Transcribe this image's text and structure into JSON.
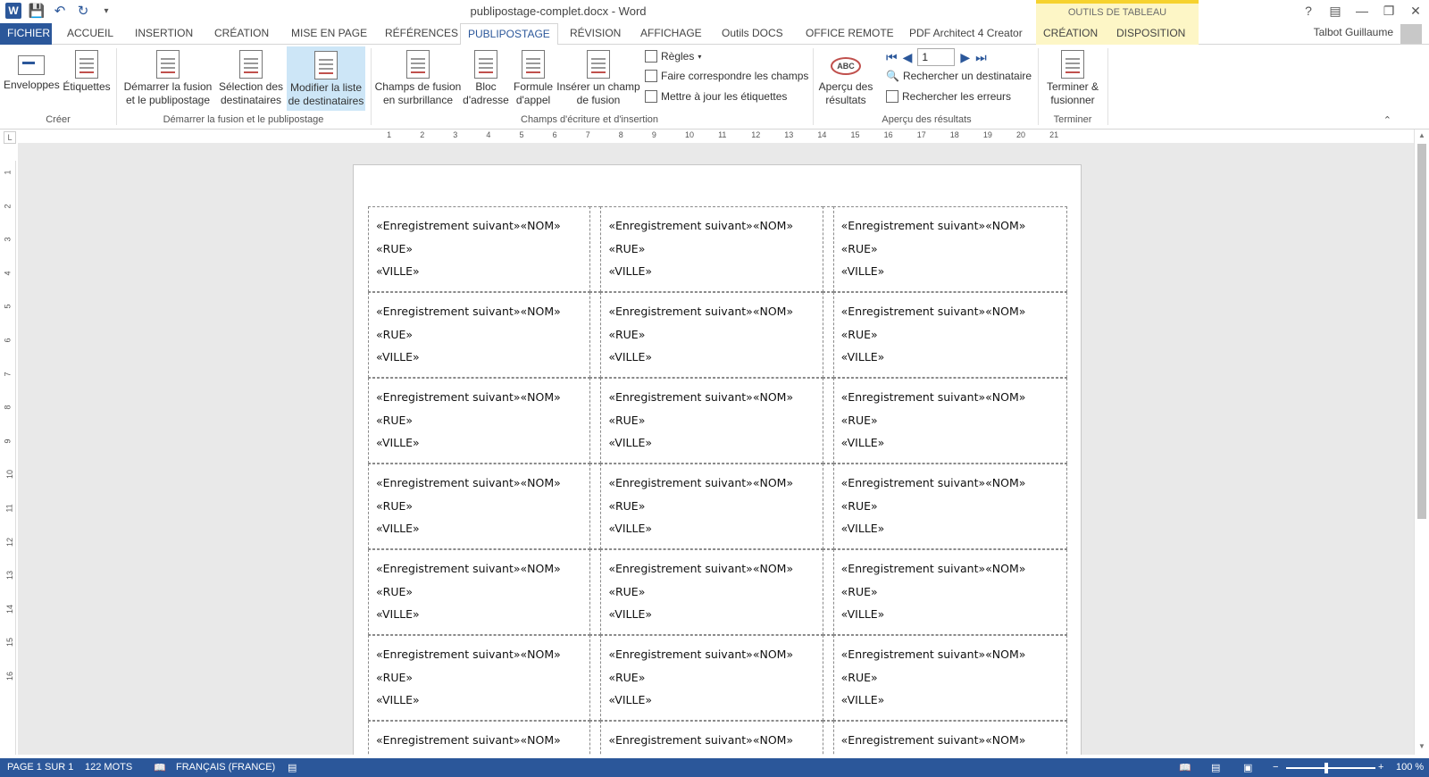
{
  "window": {
    "title": "publipostage-complet.docx - Word",
    "context_group": "OUTILS DE TABLEAU",
    "help": "?",
    "min": "—",
    "restore": "❐",
    "close": "✕"
  },
  "tabs": [
    {
      "label": "FICHIER"
    },
    {
      "label": "ACCUEIL"
    },
    {
      "label": "INSERTION"
    },
    {
      "label": "CRÉATION"
    },
    {
      "label": "MISE EN PAGE"
    },
    {
      "label": "RÉFÉRENCES"
    },
    {
      "label": "PUBLIPOSTAGE"
    },
    {
      "label": "RÉVISION"
    },
    {
      "label": "AFFICHAGE"
    },
    {
      "label": "Outils DOCS"
    },
    {
      "label": "OFFICE REMOTE"
    },
    {
      "label": "PDF Architect 4 Creator"
    },
    {
      "label": "CRÉATION"
    },
    {
      "label": "DISPOSITION"
    }
  ],
  "user_name": "Talbot Guillaume",
  "ribbon": {
    "creer": {
      "label": "Créer",
      "enveloppes": "Enveloppes",
      "etiquettes": "Étiquettes"
    },
    "demarrer": {
      "label": "Démarrer la fusion et le publipostage",
      "start_l1": "Démarrer la fusion",
      "start_l2": "et le publipostage",
      "select_l1": "Sélection des",
      "select_l2": "destinataires",
      "modify_l1": "Modifier la liste",
      "modify_l2": "de destinataires"
    },
    "champs": {
      "label": "Champs d'écriture et d'insertion",
      "highlight_l1": "Champs de fusion",
      "highlight_l2": "en surbrillance",
      "bloc_l1": "Bloc",
      "bloc_l2": "d'adresse",
      "formule_l1": "Formule",
      "formule_l2": "d'appel",
      "insert_l1": "Insérer un champ",
      "insert_l2": "de fusion",
      "regles": "Règles",
      "faire": "Faire correspondre les champs",
      "maj": "Mettre à jour les étiquettes"
    },
    "apercu": {
      "label": "Aperçu des résultats",
      "apercu_l1": "Aperçu des",
      "apercu_l2": "résultats",
      "record": "1",
      "rechercher_dest": "Rechercher un destinataire",
      "rechercher_err": "Rechercher les erreurs"
    },
    "terminer": {
      "label": "Terminer",
      "btn_l1": "Terminer &",
      "btn_l2": "fusionner"
    }
  },
  "ruler_ticks": [
    "1",
    "2",
    "3",
    "4",
    "5",
    "6",
    "7",
    "8",
    "9",
    "10",
    "11",
    "12",
    "13",
    "14",
    "15",
    "16",
    "17",
    "18",
    "19",
    "20",
    "21"
  ],
  "vruler_ticks": [
    "1",
    "2",
    "3",
    "4",
    "5",
    "6",
    "7",
    "8",
    "9",
    "10",
    "11",
    "12",
    "13",
    "14",
    "15",
    "16"
  ],
  "label_fields": {
    "line1": "«Enregistrement suivant»«NOM»",
    "line2": "«RUE»",
    "line3": "«VILLE»"
  },
  "status": {
    "page": "PAGE 1 SUR 1",
    "words": "122 MOTS",
    "language": "FRANÇAIS (FRANCE)",
    "zoom": "100 %"
  }
}
